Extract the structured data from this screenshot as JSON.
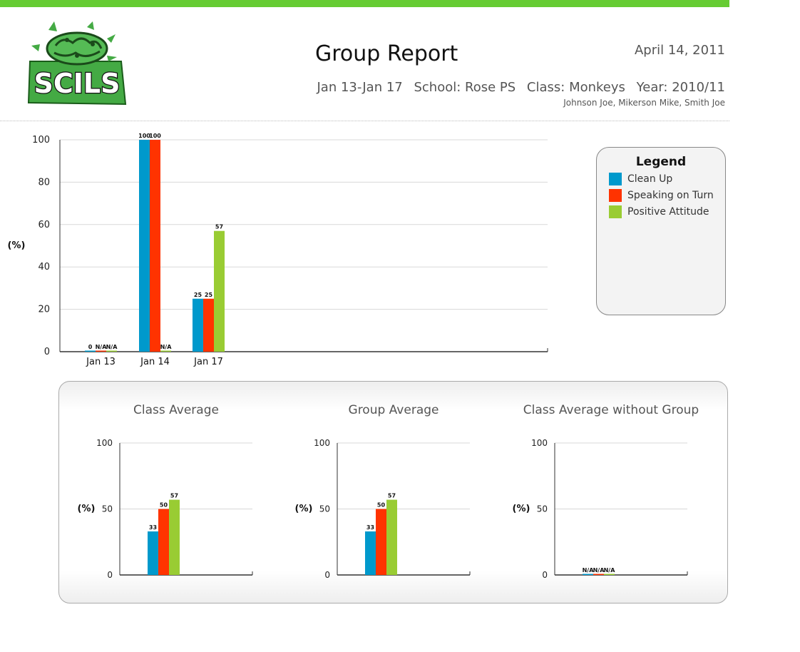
{
  "header": {
    "logo_text": "SCILS",
    "title": "Group Report",
    "date": "April 14, 2011",
    "date_range": "Jan 13-Jan 17",
    "school": "School: Rose PS",
    "class": "Class: Monkeys",
    "year": "Year: 2010/11",
    "members": "Johnson Joe, Mikerson Mike, Smith Joe"
  },
  "colors": {
    "accent_bar": "#66cc33",
    "clean_up": "#0099cc",
    "speaking": "#ff3300",
    "positive": "#99cc33"
  },
  "legend": {
    "title": "Legend",
    "items": [
      {
        "label": "Clean Up",
        "color": "#0099cc"
      },
      {
        "label": "Speaking on Turn",
        "color": "#ff3300"
      },
      {
        "label": "Positive Attitude",
        "color": "#99cc33"
      }
    ]
  },
  "chart_data": [
    {
      "type": "bar",
      "title": "",
      "ylabel": "(%)",
      "ylim": [
        0,
        100
      ],
      "yticks": [
        0,
        20,
        40,
        60,
        80,
        100
      ],
      "categories": [
        "Jan 13",
        "Jan 14",
        "Jan 17"
      ],
      "series": [
        {
          "name": "Clean Up",
          "values": [
            0,
            100,
            25
          ],
          "labels": [
            "0",
            "100",
            "25"
          ]
        },
        {
          "name": "Speaking on Turn",
          "values": [
            null,
            100,
            25
          ],
          "labels": [
            "N/A",
            "100",
            "25"
          ]
        },
        {
          "name": "Positive Attitude",
          "values": [
            null,
            null,
            57
          ],
          "labels": [
            "N/A",
            "N/A",
            "57"
          ]
        }
      ]
    },
    {
      "type": "bar",
      "title": "Class Average",
      "ylabel": "(%)",
      "ylim": [
        0,
        100
      ],
      "yticks": [
        0,
        50,
        100
      ],
      "series": [
        {
          "name": "Clean Up",
          "values": [
            33
          ],
          "labels": [
            "33"
          ]
        },
        {
          "name": "Speaking on Turn",
          "values": [
            50
          ],
          "labels": [
            "50"
          ]
        },
        {
          "name": "Positive Attitude",
          "values": [
            57
          ],
          "labels": [
            "57"
          ]
        }
      ]
    },
    {
      "type": "bar",
      "title": "Group Average",
      "ylabel": "(%)",
      "ylim": [
        0,
        100
      ],
      "yticks": [
        0,
        50,
        100
      ],
      "series": [
        {
          "name": "Clean Up",
          "values": [
            33
          ],
          "labels": [
            "33"
          ]
        },
        {
          "name": "Speaking on Turn",
          "values": [
            50
          ],
          "labels": [
            "50"
          ]
        },
        {
          "name": "Positive Attitude",
          "values": [
            57
          ],
          "labels": [
            "57"
          ]
        }
      ]
    },
    {
      "type": "bar",
      "title": "Class Average without Group",
      "ylabel": "(%)",
      "ylim": [
        0,
        100
      ],
      "yticks": [
        0,
        50,
        100
      ],
      "series": [
        {
          "name": "Clean Up",
          "values": [
            null
          ],
          "labels": [
            "N/A"
          ]
        },
        {
          "name": "Speaking on Turn",
          "values": [
            null
          ],
          "labels": [
            "N/A"
          ]
        },
        {
          "name": "Positive Attitude",
          "values": [
            null
          ],
          "labels": [
            "N/A"
          ]
        }
      ]
    }
  ]
}
